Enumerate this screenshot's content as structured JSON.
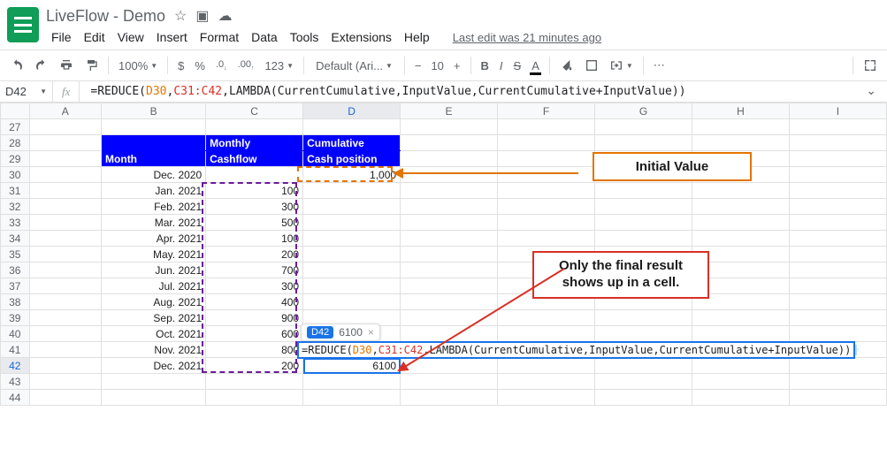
{
  "header": {
    "title": "LiveFlow - Demo",
    "last_edit": "Last edit was 21 minutes ago"
  },
  "menus": [
    "File",
    "Edit",
    "View",
    "Insert",
    "Format",
    "Data",
    "Tools",
    "Extensions",
    "Help"
  ],
  "toolbar": {
    "zoom": "100%",
    "currency": "$",
    "percent": "%",
    "dec_dec": ".0",
    "dec_inc": ".00",
    "num_fmt": "123",
    "font": "Default (Ari...",
    "size": "10",
    "text_color_letter": "A"
  },
  "namebox": "D42",
  "formula_bar": {
    "pre": "=REDUCE(",
    "a1": "D30",
    "sep1": ",",
    "a2": "C31:C42",
    "sep2": ",LAMBDA(",
    "rest": "CurrentCumulative,InputValue,CurrentCumulative+InputValue))"
  },
  "columns": [
    "A",
    "B",
    "C",
    "D",
    "E",
    "F",
    "G",
    "H",
    "I"
  ],
  "row_start": 27,
  "row_end": 44,
  "table_headers": {
    "month": "Month",
    "cash_top": "Monthly",
    "cash_bot": "Cashflow",
    "cum_top": "Cumulative",
    "cum_bot": "Cash position"
  },
  "rows": [
    {
      "month": "Dec. 2020",
      "cash": "",
      "cum": "1,000"
    },
    {
      "month": "Jan. 2021",
      "cash": "100",
      "cum": ""
    },
    {
      "month": "Feb. 2021",
      "cash": "300",
      "cum": ""
    },
    {
      "month": "Mar. 2021",
      "cash": "500",
      "cum": ""
    },
    {
      "month": "Apr. 2021",
      "cash": "100",
      "cum": ""
    },
    {
      "month": "May. 2021",
      "cash": "200",
      "cum": ""
    },
    {
      "month": "Jun. 2021",
      "cash": "700",
      "cum": ""
    },
    {
      "month": "Jul. 2021",
      "cash": "300",
      "cum": ""
    },
    {
      "month": "Aug. 2021",
      "cash": "400",
      "cum": ""
    },
    {
      "month": "Sep. 2021",
      "cash": "900",
      "cum": ""
    },
    {
      "month": "Oct. 2021",
      "cash": "600",
      "cum": ""
    },
    {
      "month": "Nov. 2021",
      "cash": "800",
      "cum": ""
    },
    {
      "month": "Dec. 2021",
      "cash": "200",
      "cum": "6100"
    }
  ],
  "tooltip": {
    "ref": "D42",
    "val": "6100",
    "close": "×"
  },
  "callouts": {
    "initial": "Initial Value",
    "final_l1": "Only the final result",
    "final_l2": "shows up in a cell."
  },
  "live_formula": {
    "pre": "=REDUCE(",
    "a1": "D30",
    "sep1": ",",
    "a2": "C31:C42",
    "sep2": ",LAMBDA(",
    "rest": "CurrentCumulative,InputValue,CurrentCumulative+InputValue))"
  }
}
